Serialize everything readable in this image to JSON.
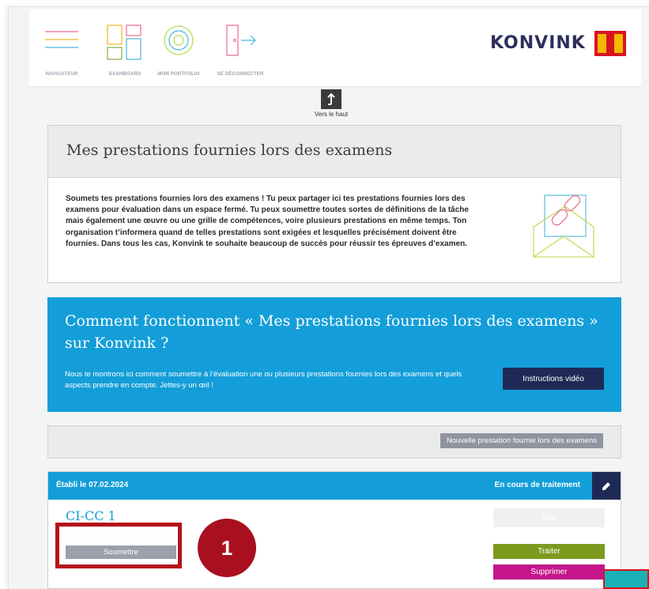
{
  "nav": {
    "items": [
      {
        "label": "NAVIGATEUR",
        "icon": "hamburger-menu-icon"
      },
      {
        "label": "DASHBOARD",
        "icon": "dashboard-grid-icon"
      },
      {
        "label": "MON PORTFOLIO",
        "icon": "portfolio-circles-icon"
      },
      {
        "label": "SE DÉCONNECTER",
        "icon": "logout-door-icon"
      }
    ]
  },
  "brand": {
    "name": "KONVINK",
    "colors": {
      "accent": "#139ed9",
      "navy": "#1e2a55",
      "logo_red": "#d8141f",
      "logo_yellow": "#f4b800"
    }
  },
  "scroll_top": {
    "label": "Vers le haut",
    "icon": "arrow-up-icon"
  },
  "intro": {
    "title": "Mes prestations fournies lors des examens",
    "body": "Soumets tes prestations fournies lors des examens ! Tu peux partager ici tes prestations fournies lors des examens pour évaluation dans un espace fermé. Tu peux soumettre toutes sortes de définitions de la tâche mais également une œuvre ou une grille de compétences, voire plusieurs prestations en même temps. Ton organisation t’informera quand de telles prestations sont exigées et lesquelles précisément doivent être fournies. Dans tous les cas, Konvink te souhaite beaucoup de succès pour réussir tes épreuves d’examen.",
    "illustration": "envelope-link-icon"
  },
  "howto": {
    "title": "Comment fonctionnent « Mes prestations fournies lors des examens » sur Konvink ?",
    "text": "Nous te montrons ici comment soumettre à l’évaluation une ou plusieurs prestations fournies lors des examens et quels aspects prendre en compte. Jettes-y un œil !",
    "button": "Instructions vidéo"
  },
  "actions": {
    "new_button": "Nouvelle prestation fournie lors des examens"
  },
  "entry": {
    "date": "Établi le 07.02.2024",
    "status": "En cours de traitement",
    "edit_icon": "pencil-icon",
    "title": "CI-CC 1",
    "submit": "Soumettre",
    "view": "Voir",
    "process": "Traiter",
    "delete": "Supprimer"
  },
  "annotation": {
    "step": "1",
    "color": "#a8101f"
  }
}
